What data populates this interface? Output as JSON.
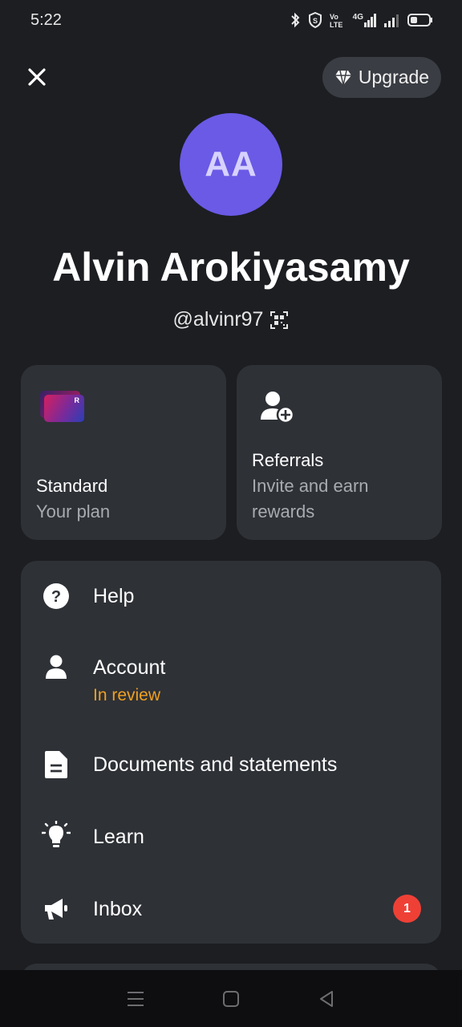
{
  "status_bar": {
    "time": "5:22",
    "network_text": "4G"
  },
  "header": {
    "upgrade_label": "Upgrade"
  },
  "profile": {
    "initials": "AA",
    "name": "Alvin Arokiyasamy",
    "handle": "@alvinr97",
    "avatar_color": "#6a5ae6"
  },
  "cards": {
    "plan": {
      "title": "Standard",
      "subtitle": "Your plan",
      "card_letter": "R"
    },
    "referrals": {
      "title": "Referrals",
      "subtitle_line1": "Invite and earn",
      "subtitle_line2": "rewards"
    }
  },
  "menu": {
    "help": {
      "label": "Help",
      "icon": "help-circle-icon"
    },
    "account": {
      "label": "Account",
      "status": "In review",
      "icon": "person-icon",
      "status_color": "#f0a020"
    },
    "documents": {
      "label": "Documents and statements",
      "icon": "document-icon"
    },
    "learn": {
      "label": "Learn",
      "icon": "lightbulb-icon"
    },
    "inbox": {
      "label": "Inbox",
      "badge": "1",
      "icon": "megaphone-icon",
      "badge_color": "#ef4036"
    }
  },
  "nav": {
    "recents_icon": "menu-lines-icon",
    "home_icon": "square-icon",
    "back_icon": "triangle-back-icon"
  }
}
